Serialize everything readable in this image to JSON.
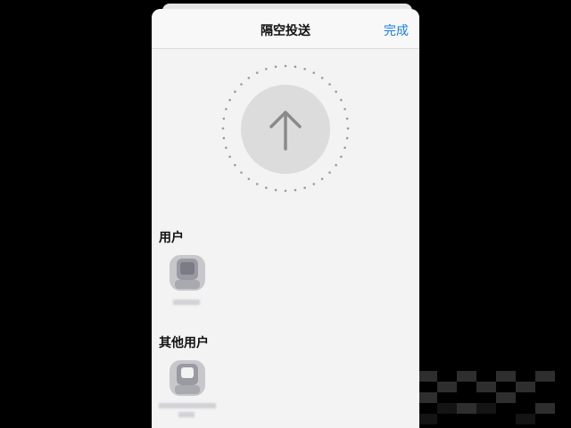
{
  "header": {
    "title": "隔空投送",
    "done_label": "完成"
  },
  "sections": {
    "users_label": "用户",
    "other_users_label": "其他用户"
  },
  "icons": {
    "upload": "arrow-up-icon",
    "avatar": "person-avatar-icon"
  },
  "colors": {
    "accent": "#1a7fd6",
    "sheet_background": "#f3f3f3",
    "page_background": "#000000"
  }
}
